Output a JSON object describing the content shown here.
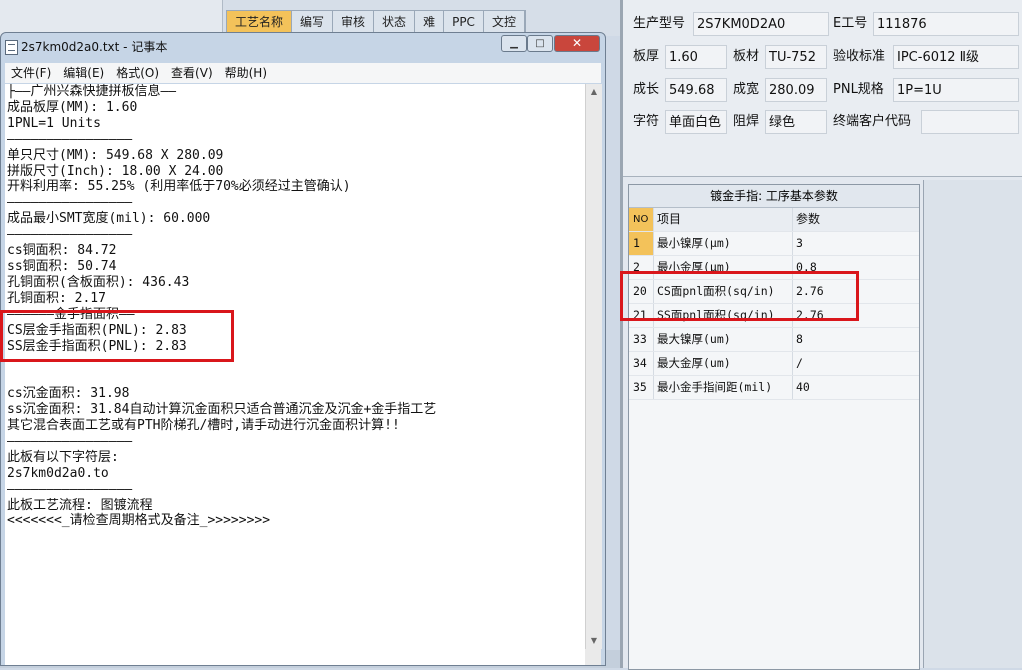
{
  "bg_tabs": [
    "工艺名称",
    "编写",
    "审核",
    "状态",
    "难",
    "PPC",
    "文控"
  ],
  "right_fields": {
    "row1": [
      {
        "label": "生产型号",
        "value": "2S7KM0D2A0"
      },
      {
        "label": "E工号",
        "value": "111876"
      }
    ],
    "row2": [
      {
        "label": "板厚",
        "value": "1.60"
      },
      {
        "label": "板材",
        "value": "TU-752"
      },
      {
        "label": "验收标准",
        "value": "IPC-6012 Ⅱ级"
      }
    ],
    "row3": [
      {
        "label": "成长",
        "value": "549.68"
      },
      {
        "label": "成宽",
        "value": "280.09"
      },
      {
        "label": "PNL规格",
        "value": "1P=1U"
      }
    ],
    "row4": [
      {
        "label": "字符",
        "value": "单面白色"
      },
      {
        "label": "阻焊",
        "value": "绿色"
      },
      {
        "label": "终端客户代码",
        "value": ""
      }
    ]
  },
  "param_grid": {
    "title": "镀金手指: 工序基本参数",
    "headers": [
      "NO",
      "项目",
      "参数"
    ],
    "rows": [
      [
        "1",
        "最小镍厚(μm)",
        "3"
      ],
      [
        "2",
        "最小金厚(μm)",
        "0.8"
      ],
      [
        "20",
        "CS面pnl面积(sq/in)",
        "2.76"
      ],
      [
        "21",
        "SS面pnl面积(sq/in)",
        "2.76"
      ],
      [
        "33",
        "最大镍厚(um)",
        "8"
      ],
      [
        "34",
        "最大金厚(um)",
        "/"
      ],
      [
        "35",
        "最小金手指间距(mil)",
        "40"
      ]
    ]
  },
  "notepad": {
    "title": "2s7km0d2a0.txt - 记事本",
    "menu": [
      "文件(F)",
      "编辑(E)",
      "格式(O)",
      "查看(V)",
      "帮助(H)"
    ],
    "lines": [
      "├——广州兴森快捷拼板信息——",
      "成品板厚(MM): 1.60",
      "1PNL=1 Units",
      "————————————————",
      "单只尺寸(MM): 549.68 X 280.09",
      "拼版尺寸(Inch): 18.00 X 24.00",
      "开料利用率: 55.25% (利用率低于70%必须经过主管确认)",
      "————————————————",
      "成品最小SMT宽度(mil): 60.000",
      "————————————————",
      "cs铜面积: 84.72",
      "ss铜面积: 50.74",
      "孔铜面积(含板面积): 436.43",
      "孔铜面积: 2.17",
      "——————金手指面积——",
      "CS层金手指面积(PNL): 2.83",
      "SS层金手指面积(PNL): 2.83",
      "————————————————",
      "",
      "cs沉金面积: 31.98",
      "ss沉金面积: 31.84自动计算沉金面积只适合普通沉金及沉金+金手指工艺",
      "其它混合表面工艺或有PTH阶梯孔/槽时,请手动进行沉金面积计算!!",
      "————————————————",
      "此板有以下字符层:",
      "2s7km0d2a0.to",
      "————————————————",
      "此板工艺流程: 图镀流程",
      "<<<<<<<_请检查周期格式及备注_>>>>>>>>"
    ]
  },
  "colors": {
    "highlight": "#d9161b",
    "selected": "#f3c25a"
  }
}
